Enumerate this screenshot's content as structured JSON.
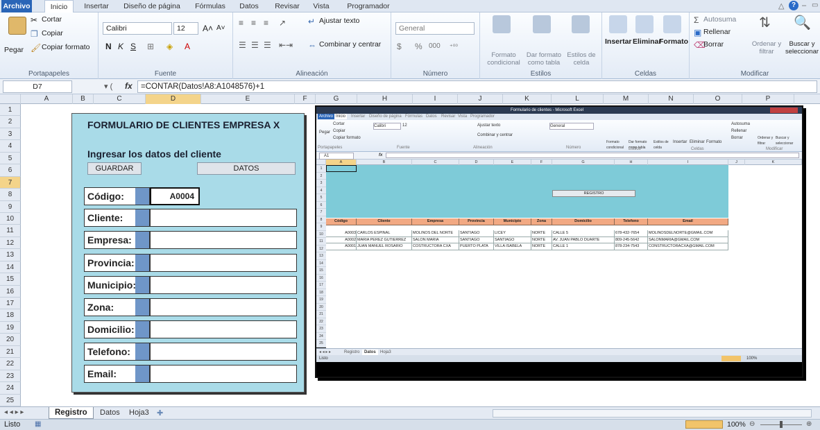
{
  "tabs": [
    "Archivo",
    "Inicio",
    "Insertar",
    "Diseño de página",
    "Fórmulas",
    "Datos",
    "Revisar",
    "Vista",
    "Programador"
  ],
  "ribbon": {
    "clipboard": {
      "paste": "Pegar",
      "cut": "Cortar",
      "copy": "Copiar",
      "copy_format": "Copiar formato",
      "label": "Portapapeles"
    },
    "font": {
      "name": "Calibri",
      "size": "12",
      "bold": "N",
      "italic": "K",
      "underline": "S",
      "label": "Fuente"
    },
    "alignment": {
      "wrap": "Ajustar texto",
      "merge": "Combinar y centrar",
      "label": "Alineación"
    },
    "number": {
      "format": "General",
      "percent": "%",
      "thousands": "000",
      "label": "Número"
    },
    "styles": {
      "conditional": "Formato condicional",
      "table": "Dar formato como tabla",
      "cell": "Estilos de celda",
      "label": "Estilos"
    },
    "cells": {
      "insert": "Insertar",
      "delete": "Eliminar",
      "format": "Formato",
      "label": "Celdas"
    },
    "editing": {
      "autosum": "Autosuma",
      "fill": "Rellenar",
      "clear": "Borrar",
      "sort": "Ordenar y filtrar",
      "find": "Buscar y seleccionar",
      "label": "Modificar"
    }
  },
  "formula_bar": {
    "cell_ref": "D7",
    "fx": "fx",
    "formula": "=CONTAR(Datos!A8:A1048576)+1"
  },
  "columns": [
    "A",
    "B",
    "C",
    "D",
    "E",
    "F",
    "G",
    "H",
    "I",
    "J",
    "K",
    "L",
    "M",
    "N",
    "O",
    "P"
  ],
  "rows": [
    "1",
    "2",
    "3",
    "4",
    "5",
    "6",
    "7",
    "8",
    "9",
    "10",
    "11",
    "12",
    "13",
    "14",
    "15",
    "16",
    "17",
    "18",
    "19",
    "20",
    "21",
    "22",
    "23",
    "24",
    "25"
  ],
  "form": {
    "title": "FORMULARIO DE CLIENTES EMPRESA X",
    "subtitle": "Ingresar los datos del cliente",
    "save_button": "GUARDAR",
    "data_button": "DATOS",
    "code_value": "A0004",
    "fields": [
      "Código:",
      "Cliente:",
      "Empresa:",
      "Provincia:",
      "Municipio:",
      "Zona:",
      "Domicilio:",
      "Telefono:",
      "Email:"
    ]
  },
  "embedded": {
    "window_title": "Formulario de clientes - Microsoft Excel",
    "tabs": [
      "Archivo",
      "Inicio",
      "Insertar",
      "Diseño de página",
      "Fórmulas",
      "Datos",
      "Revisar",
      "Vista",
      "Programador"
    ],
    "cell_ref": "A1",
    "columns": [
      "A",
      "B",
      "C",
      "D",
      "E",
      "F",
      "G",
      "H",
      "I",
      "J",
      "K"
    ],
    "register_button": "REGISTRO",
    "headers": [
      "Código",
      "Cliente",
      "Empresa",
      "Provincia",
      "Municipio",
      "Zona",
      "Domicilio",
      "Telefono",
      "Email"
    ],
    "records": [
      [
        "A0003",
        "CARLOS ESPINAL",
        "MOLINOS DEL NORTE",
        "SANTIAGO",
        "LICEY",
        "NORTE",
        "CALLE 5",
        "678-432-7654",
        "MOLINOSDELNORTE@GMAIL.COM"
      ],
      [
        "A0002",
        "MARIA PEREZ GUTIERREZ",
        "SALON MARIA",
        "SANTIAGO",
        "SANTIAGO",
        "NORTE",
        "AV. JUAN PABLO DUARTE",
        "809-245-5642",
        "SALONMARIA@GMAIL.COM"
      ],
      [
        "A0001",
        "JUAN MANUEL ROSARIO",
        "COSTRUCTORA CXA",
        "PUERTO PLATA",
        "VILLA ISABELA",
        "NORTE",
        "CALLE 1",
        "878-234-7543",
        "CONSTRUCTORACXA@GMAIL.COM"
      ]
    ],
    "sheet_tabs": [
      "Registro",
      "Datos",
      "Hoja3"
    ],
    "status": "Listo",
    "zoom": "100%"
  },
  "sheet_tabs": [
    "Registro",
    "Datos",
    "Hoja3"
  ],
  "status": {
    "ready": "Listo",
    "zoom": "100%"
  }
}
